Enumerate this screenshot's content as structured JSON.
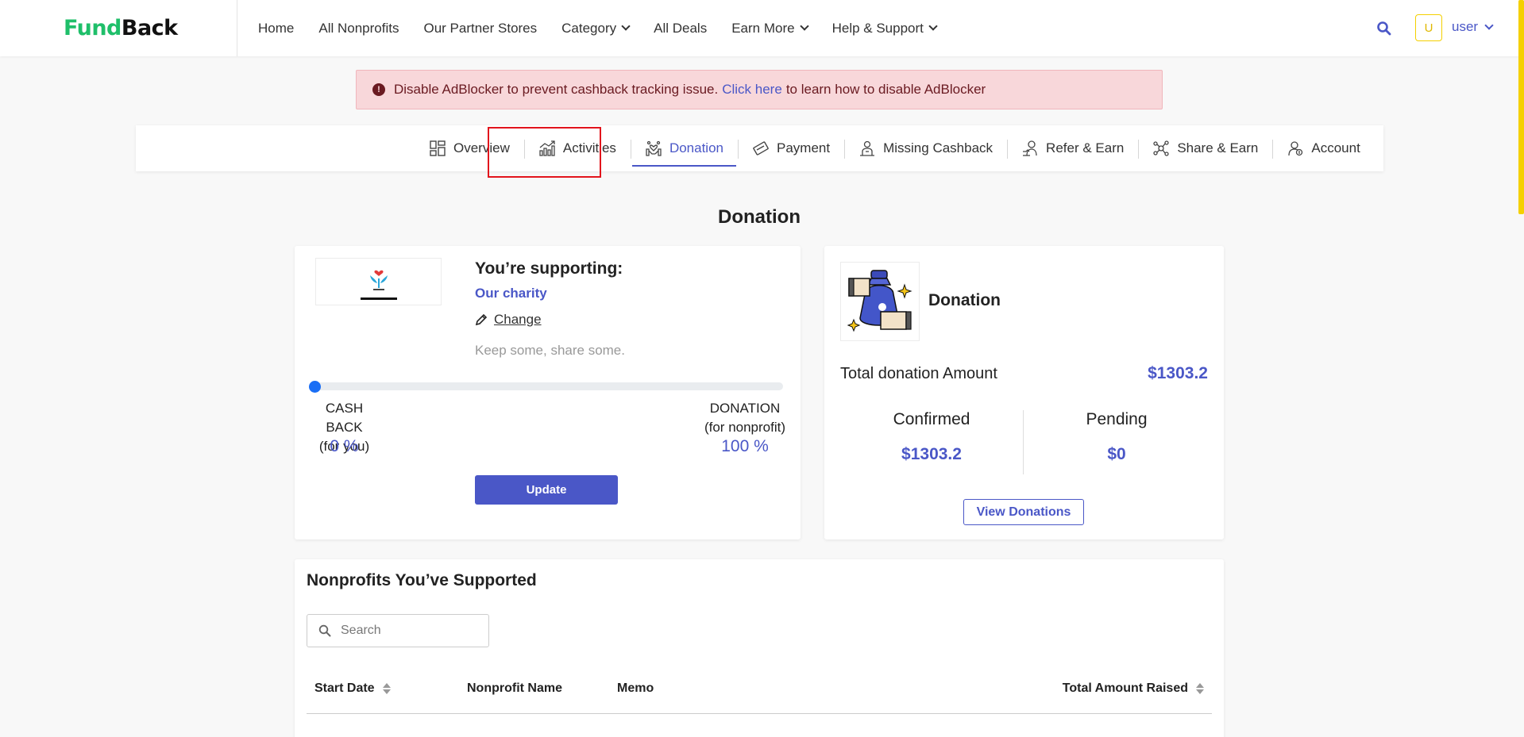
{
  "brand": {
    "part1": "Fund",
    "part2": "Back"
  },
  "nav": {
    "items": [
      {
        "label": "Home",
        "dropdown": false
      },
      {
        "label": "All Nonprofits",
        "dropdown": false
      },
      {
        "label": "Our Partner Stores",
        "dropdown": false
      },
      {
        "label": "Category",
        "dropdown": true
      },
      {
        "label": "All Deals",
        "dropdown": false
      },
      {
        "label": "Earn More",
        "dropdown": true
      },
      {
        "label": "Help & Support",
        "dropdown": true
      }
    ],
    "avatar_letter": "U",
    "username": "user"
  },
  "alert": {
    "text_before": "Disable AdBlocker to prevent cashback tracking issue.",
    "link": "Click here",
    "text_after": "to learn how to disable AdBlocker"
  },
  "tabs": [
    {
      "label": "Overview",
      "icon": "overview-icon",
      "active": false
    },
    {
      "label": "Activities",
      "icon": "activities-icon",
      "active": false
    },
    {
      "label": "Donation",
      "icon": "donation-icon",
      "active": true
    },
    {
      "label": "Payment",
      "icon": "payment-icon",
      "active": false
    },
    {
      "label": "Missing Cashback",
      "icon": "missing-cashback-icon",
      "active": false
    },
    {
      "label": "Refer & Earn",
      "icon": "refer-icon",
      "active": false
    },
    {
      "label": "Share & Earn",
      "icon": "share-icon",
      "active": false
    },
    {
      "label": "Account",
      "icon": "account-icon",
      "active": false
    }
  ],
  "page": {
    "title": "Donation"
  },
  "supporting": {
    "heading": "You’re supporting:",
    "charity": "Our charity",
    "change": "Change",
    "tagline": "Keep some, share some.",
    "slider_value": 0,
    "cashback_label": "CASH BACK",
    "cashback_sub": "(for you)",
    "cashback_pct": "0 %",
    "donation_label": "DONATION",
    "donation_sub": "(for nonprofit)",
    "donation_pct": "100 %",
    "update": "Update"
  },
  "summary": {
    "heading": "Donation",
    "total_label": "Total donation Amount",
    "total_value": "$1303.2",
    "confirmed_label": "Confirmed",
    "confirmed_value": "$1303.2",
    "pending_label": "Pending",
    "pending_value": "$0",
    "view_button": "View Donations"
  },
  "nonprofits": {
    "title": "Nonprofits You’ve Supported",
    "search_placeholder": "Search",
    "columns": [
      "Start Date",
      "Nonprofit Name",
      "Memo",
      "Total Amount Raised"
    ]
  },
  "colors": {
    "accent": "#4a57c7",
    "brand_green": "#1fbf6a",
    "alert_bg": "#f8d7da",
    "highlight": "#e2141c"
  }
}
